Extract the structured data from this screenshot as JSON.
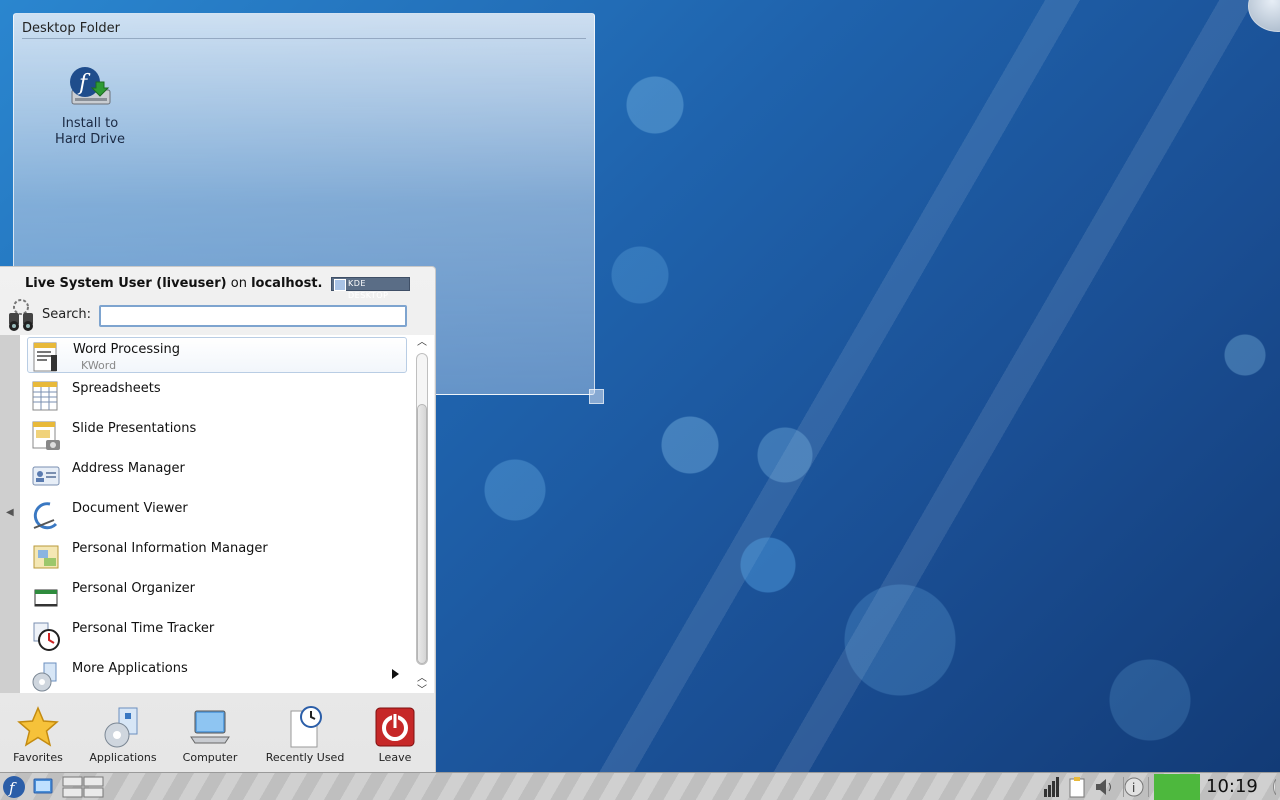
{
  "desktop_folder": {
    "title": "Desktop Folder",
    "icon": {
      "name": "install-hard-drive-icon",
      "label_line1": "Install to",
      "label_line2": "Hard Drive"
    }
  },
  "kickoff": {
    "user_display": "Live System User (liveuser)",
    "on_text": "on",
    "host": "localhost.",
    "badge": "KDE DESKTOP",
    "search_label": "Search:",
    "search_value": "",
    "apps": [
      {
        "name": "Word Processing",
        "subtitle": "KWord",
        "icon": "word-processor-icon"
      },
      {
        "name": "Spreadsheets",
        "icon": "spreadsheet-icon"
      },
      {
        "name": "Slide Presentations",
        "icon": "presentation-icon"
      },
      {
        "name": "Address Manager",
        "icon": "address-book-icon"
      },
      {
        "name": "Document Viewer",
        "icon": "document-viewer-icon"
      },
      {
        "name": "Personal Information Manager",
        "icon": "pim-icon"
      },
      {
        "name": "Personal Organizer",
        "icon": "organizer-icon"
      },
      {
        "name": "Personal Time Tracker",
        "icon": "time-tracker-icon"
      },
      {
        "name": "More Applications",
        "icon": "more-apps-icon"
      }
    ],
    "tabs": [
      {
        "label": "Favorites",
        "icon": "star-icon"
      },
      {
        "label": "Applications",
        "icon": "applications-icon"
      },
      {
        "label": "Computer",
        "icon": "computer-icon"
      },
      {
        "label": "Recently Used",
        "icon": "clock-document-icon"
      },
      {
        "label": "Leave",
        "icon": "power-icon"
      }
    ]
  },
  "taskbar": {
    "clock": "10:19"
  },
  "colors": {
    "accent": "#7ea4cf",
    "leave_red": "#c62828",
    "tray_green": "#4db83d"
  }
}
